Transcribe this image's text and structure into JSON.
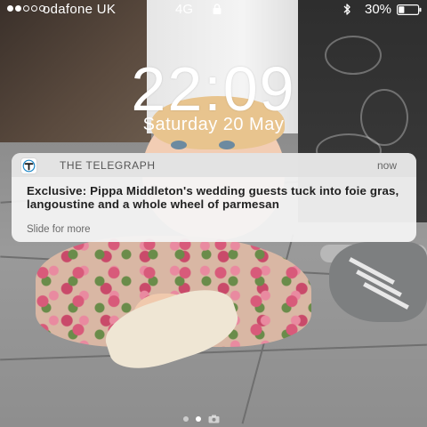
{
  "status_bar": {
    "signal_bars": 5,
    "signal_filled": 2,
    "carrier": "odafone UK",
    "network": "4G",
    "battery_percent": "30%",
    "battery_level": 0.3
  },
  "lock_screen": {
    "time": "22:09",
    "date": "Saturday 20 May"
  },
  "notification": {
    "app_icon": "telegraph-t-icon",
    "app_name": "THE TELEGRAPH",
    "time": "now",
    "title": "Exclusive: Pippa Middleton's wedding guests tuck into foie gras, langoustine and a whole wheel of parmesan",
    "hint": "Slide for more"
  },
  "page_indicator": {
    "pages": 2,
    "active_index": 1,
    "trailing_icon": "camera-icon"
  },
  "colors": {
    "notification_bg": "#f4f4f4",
    "notification_header_bg": "#e1e1e1",
    "app_icon_accent": "#1e88c8"
  }
}
